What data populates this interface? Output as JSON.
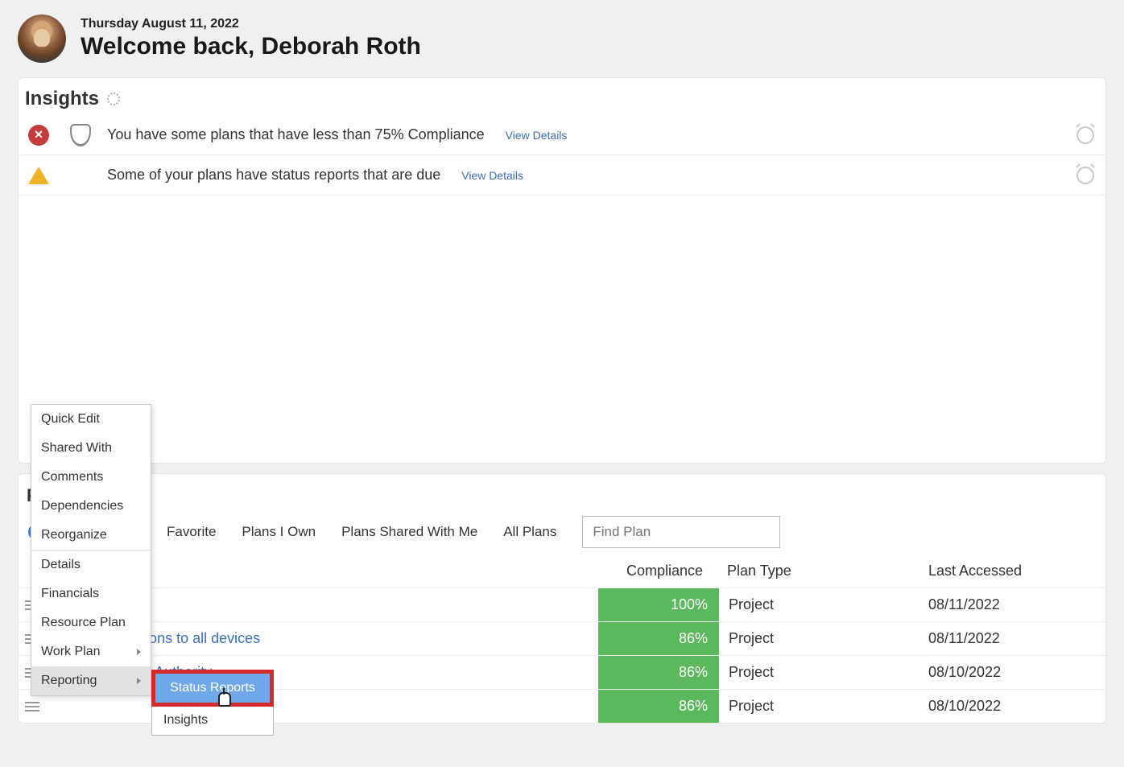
{
  "header": {
    "date": "Thursday August 11, 2022",
    "welcome": "Welcome back, Deborah Roth"
  },
  "insights": {
    "title": "Insights",
    "rows": [
      {
        "text": "You have some plans that have less than 75% Compliance",
        "link": "View Details",
        "type": "error"
      },
      {
        "text": "Some of your plans have status reports that are due",
        "link": "View Details",
        "type": "warning"
      }
    ]
  },
  "plans": {
    "title_initial": "P",
    "tabs": {
      "favorite": "Favorite",
      "own": "Plans I Own",
      "shared": "Plans Shared With Me",
      "all": "All Plans"
    },
    "search_placeholder": "Find Plan",
    "columns": {
      "compliance": "Compliance",
      "plan_type": "Plan Type",
      "last_accessed": "Last Accessed"
    },
    "rows": [
      {
        "name": "",
        "compliance": "100%",
        "plan_type": "Project",
        "last_accessed": "08/11/2022"
      },
      {
        "name": "port applications to all devices",
        "compliance": "86%",
        "plan_type": "Project",
        "last_accessed": "08/11/2022"
      },
      {
        "name": "Metro Transit Authority",
        "compliance": "86%",
        "plan_type": "Project",
        "last_accessed": "08/10/2022"
      },
      {
        "name": "",
        "compliance": "86%",
        "plan_type": "Project",
        "last_accessed": "08/10/2022"
      }
    ]
  },
  "context_menu": {
    "items": {
      "quick_edit": "Quick Edit",
      "shared_with": "Shared With",
      "comments": "Comments",
      "dependencies": "Dependencies",
      "reorganize": "Reorganize",
      "details": "Details",
      "financials": "Financials",
      "resource_plan": "Resource Plan",
      "work_plan": "Work Plan",
      "reporting": "Reporting"
    },
    "submenu": {
      "status_reports": "Status Reports",
      "insights": "Insights"
    }
  }
}
